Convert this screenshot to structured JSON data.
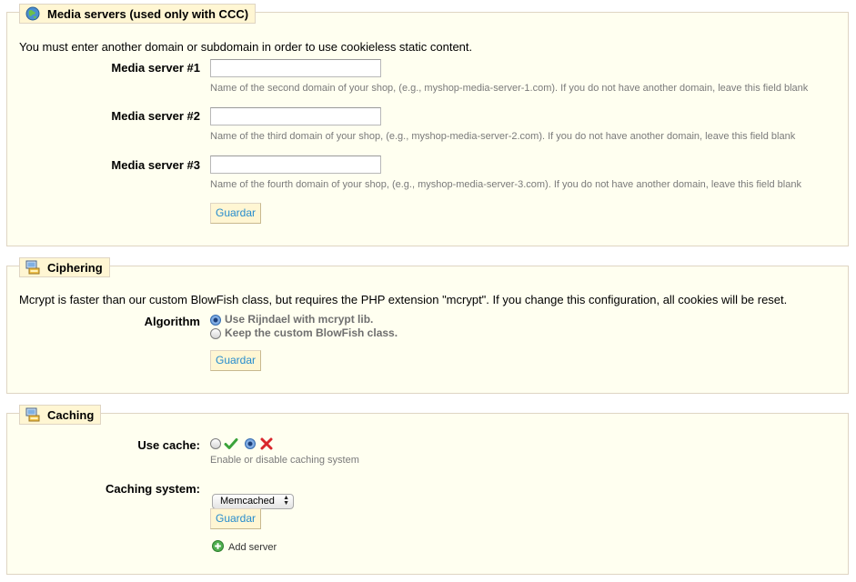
{
  "media": {
    "legend": "Media servers (used only with CCC)",
    "intro": "You must enter another domain or subdomain in order to use cookieless static content.",
    "servers": [
      {
        "label": "Media server #1",
        "value": "",
        "hint": "Name of the second domain of your shop, (e.g., myshop-media-server-1.com). If you do not have another domain, leave this field blank"
      },
      {
        "label": "Media server #2",
        "value": "",
        "hint": "Name of the third domain of your shop, (e.g., myshop-media-server-2.com). If you do not have another domain, leave this field blank"
      },
      {
        "label": "Media server #3",
        "value": "",
        "hint": "Name of the fourth domain of your shop, (e.g., myshop-media-server-3.com). If you do not have another domain, leave this field blank"
      }
    ],
    "save_label": "Guardar"
  },
  "ciphering": {
    "legend": "Ciphering",
    "intro": "Mcrypt is faster than our custom BlowFish class, but requires the PHP extension \"mcrypt\". If you change this configuration, all cookies will be reset.",
    "algorithm_label": "Algorithm",
    "options": [
      {
        "label": "Use Rijndael with mcrypt lib.",
        "checked": true
      },
      {
        "label": "Keep the custom BlowFish class.",
        "checked": false
      }
    ],
    "save_label": "Guardar"
  },
  "caching": {
    "legend": "Caching",
    "use_cache_label": "Use cache:",
    "use_cache_value": "disabled",
    "use_cache_hint": "Enable or disable caching system",
    "system_label": "Caching system:",
    "system_value": "Memcached",
    "save_label": "Guardar",
    "add_server_label": "Add server"
  },
  "colors": {
    "panel_bg": "#fffff0",
    "legend_bg": "#fff6d3",
    "border": "#dfd5c3",
    "button_text": "#268ccd",
    "enable_green": "#3aa33a",
    "disable_red": "#d9262c"
  },
  "icons": {
    "media_legend": "globe-icon",
    "ciphering_legend": "computer-icon",
    "caching_legend": "computer-icon",
    "enable": "checkmark-icon",
    "disable": "cross-icon",
    "add_server": "add-icon"
  }
}
